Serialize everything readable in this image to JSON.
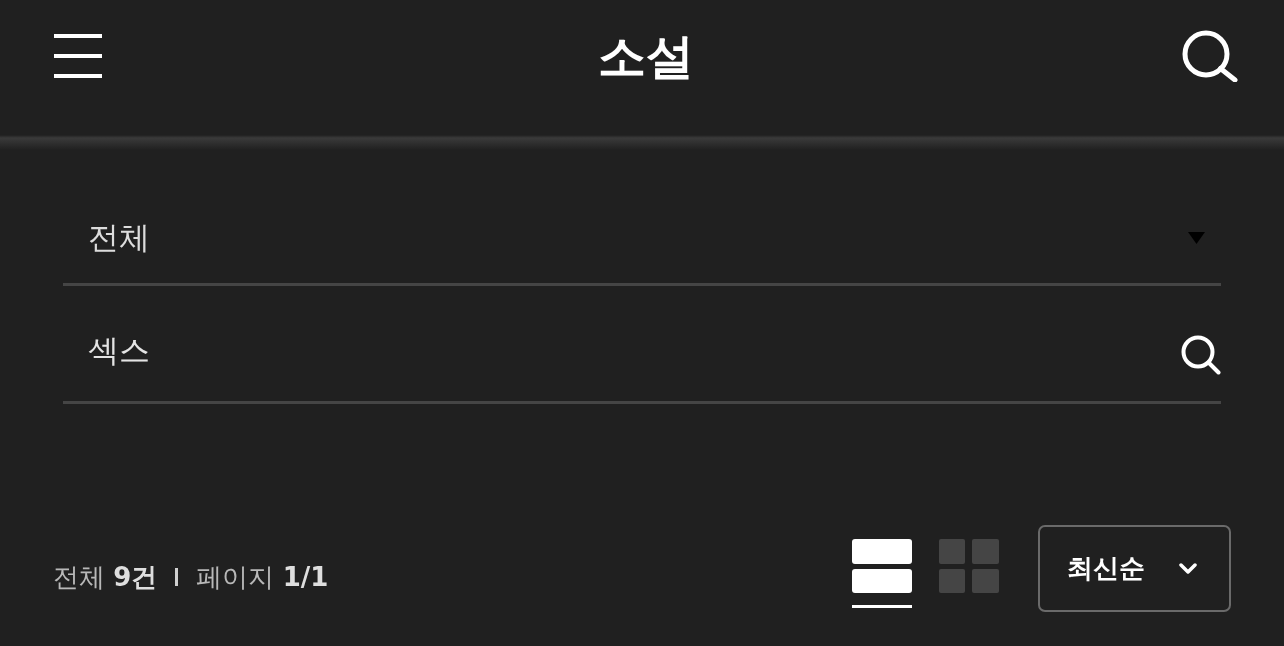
{
  "header": {
    "title": "소설"
  },
  "filters": {
    "category": {
      "value": "전체"
    },
    "search": {
      "value": "섹스"
    }
  },
  "summary": {
    "total": "전체 **9건**",
    "pages": "페이지 **1/1**"
  },
  "view_modes": [
    {
      "kind": "list",
      "selected": true
    },
    {
      "kind": "grid",
      "selected": false
    }
  ],
  "sort": {
    "label": "최신순"
  }
}
